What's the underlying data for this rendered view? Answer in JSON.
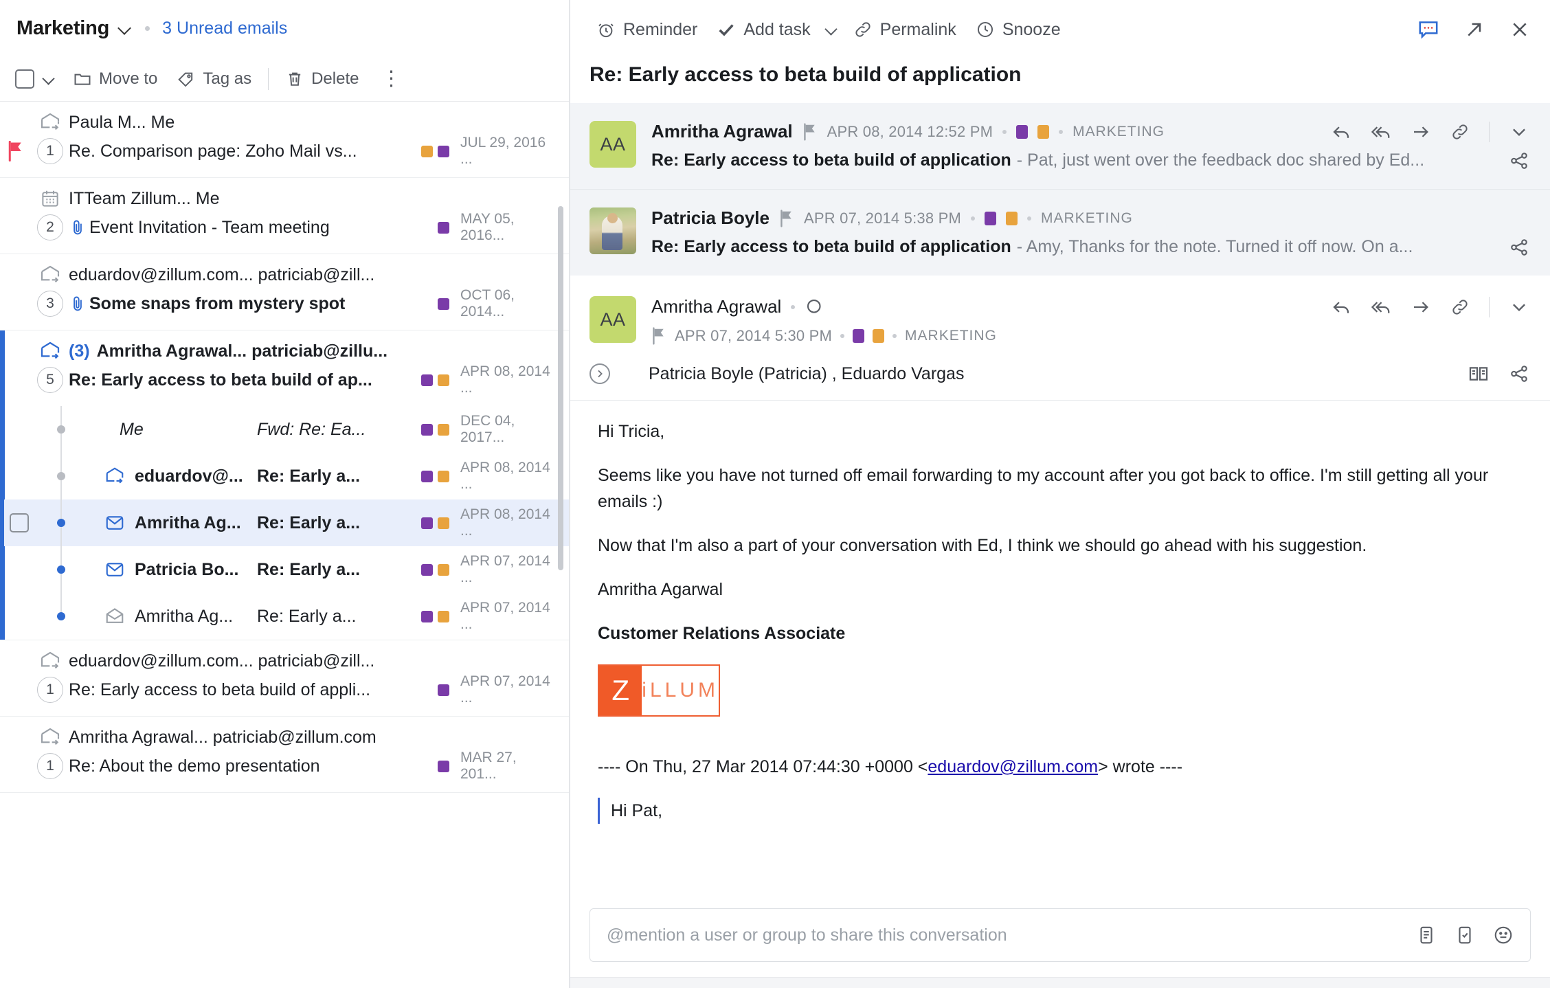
{
  "left": {
    "header": {
      "folder": "Marketing",
      "unread": "3 Unread emails"
    },
    "toolbar": {
      "move_to": "Move to",
      "tag_as": "Tag as",
      "delete": "Delete",
      "more": "⋮"
    },
    "threads": [
      {
        "senders": "Paula M... Me",
        "subject": "Re. Comparison page: Zoho Mail vs...",
        "count": "1",
        "date": "JUL 29, 2016 ...",
        "flagged": true,
        "tags": [
          "#e8a33d",
          "#7a3ba8"
        ],
        "icon": "envelope-forward-icon"
      },
      {
        "senders": "ITTeam Zillum... Me",
        "subject": "Event Invitation - Team meeting",
        "count": "2",
        "date": "MAY 05, 2016...",
        "flagged": false,
        "attachment": true,
        "tags": [
          "#7a3ba8"
        ],
        "icon": "calendar-icon"
      },
      {
        "senders": "eduardov@zillum.com... patriciab@zill...",
        "subject": "Some snaps from mystery spot",
        "count": "3",
        "date": "OCT 06, 2014...",
        "flagged": false,
        "attachment": true,
        "tags": [
          "#7a3ba8"
        ],
        "icon": "envelope-forward-icon"
      },
      {
        "senders_prefix": "(3)",
        "senders": "Amritha Agrawal... patriciab@zillu...",
        "subject": "Re: Early access to beta build of ap...",
        "count": "5",
        "date": "APR 08, 2014 ...",
        "unread": true,
        "active": true,
        "tags": [
          "#7a3ba8",
          "#e8a33d"
        ],
        "icon": "envelope-forward-icon"
      },
      {
        "senders": "eduardov@zillum.com... patriciab@zill...",
        "subject": "Re: Early access to beta build of appli...",
        "count": "1",
        "date": "APR 07, 2014 ...",
        "tags": [
          "#7a3ba8"
        ],
        "icon": "envelope-forward-icon"
      },
      {
        "senders": "Amritha Agrawal... patriciab@zillum.com",
        "subject": "Re: About the demo presentation",
        "count": "1",
        "date": "MAR 27, 201...",
        "tags": [
          "#7a3ba8"
        ],
        "icon": "envelope-forward-icon"
      }
    ],
    "subthreads": [
      {
        "sender": "Me",
        "subject": "Fwd: Re: Ea...",
        "date": "DEC 04, 2017...",
        "tags": [
          "#7a3ba8",
          "#e8a33d"
        ],
        "style": "italic",
        "icon": "none",
        "dot": "grey",
        "selected": false
      },
      {
        "sender": "eduardov@...",
        "subject": "Re: Early a...",
        "date": "APR 08, 2014 ...",
        "tags": [
          "#7a3ba8",
          "#e8a33d"
        ],
        "style": "bold",
        "icon": "envelope-forward-icon",
        "dot": "grey",
        "selected": false
      },
      {
        "sender": "Amritha Ag...",
        "subject": "Re: Early a...",
        "date": "APR 08, 2014 ...",
        "tags": [
          "#7a3ba8",
          "#e8a33d"
        ],
        "style": "bold",
        "icon": "envelope-closed-blue-icon",
        "dot": "blue",
        "selected": true
      },
      {
        "sender": "Patricia Bo...",
        "subject": "Re: Early a...",
        "date": "APR 07, 2014 ...",
        "tags": [
          "#7a3ba8",
          "#e8a33d"
        ],
        "style": "bold",
        "icon": "envelope-closed-blue-icon",
        "dot": "blue",
        "selected": false
      },
      {
        "sender": "Amritha Ag...",
        "subject": "Re: Early a...",
        "date": "APR 07, 2014 ...",
        "tags": [
          "#7a3ba8",
          "#e8a33d"
        ],
        "style": "normal",
        "icon": "envelope-open-icon",
        "dot": "blue",
        "selected": false
      }
    ]
  },
  "right": {
    "toolbar": {
      "reminder": "Reminder",
      "add_task": "Add task",
      "permalink": "Permalink",
      "snooze": "Snooze"
    },
    "subject": "Re: Early access to beta build of application",
    "messages": [
      {
        "sender": "Amritha Agrawal",
        "avatar_initials": "AA",
        "avatar_type": "initials",
        "avatar_color": "#c3d96e",
        "time": "APR 08, 2014 12:52 PM",
        "label": "MARKETING",
        "tags": [
          "#7a3ba8",
          "#e8a33d"
        ],
        "snippet_subject": "Re: Early access to beta build of application",
        "snippet_text": "- Pat, just went over the feedback doc shared by Ed...",
        "flagged": true
      },
      {
        "sender": "Patricia Boyle",
        "avatar_type": "photo",
        "time": "APR 07, 2014 5:38 PM",
        "label": "MARKETING",
        "tags": [
          "#7a3ba8",
          "#e8a33d"
        ],
        "snippet_subject": "Re: Early access to beta build of application",
        "snippet_text": "- Amy, Thanks for the note. Turned it off now. On a...",
        "flagged": true
      }
    ],
    "expanded": {
      "sender": "Amritha Agrawal",
      "avatar_initials": "AA",
      "avatar_color": "#c3d96e",
      "time": "APR 07, 2014 5:30 PM",
      "label": "MARKETING",
      "tags": [
        "#7a3ba8",
        "#e8a33d"
      ],
      "recipients": "Patricia Boyle (Patricia) , Eduardo Vargas",
      "body": {
        "greeting": "Hi Tricia,",
        "para1": "Seems like you have not turned off email forwarding to my account after you got back to office. I'm still getting all your emails :)",
        "para2": "Now that I'm also a part of your conversation with Ed, I think we should go ahead with his suggestion.",
        "sig_name": "Amritha Agarwal",
        "sig_title": "Customer Relations Associate",
        "logo_left": "Z",
        "logo_right": "iLLUM"
      },
      "quote": {
        "prefix": "---- On Thu, 27 Mar 2014 07:44:30 +0000 <",
        "email": "eduardov@zillum.com",
        "suffix": "> wrote ----",
        "text": "Hi Pat,"
      }
    },
    "mention": {
      "placeholder": "@mention a user or group to share this conversation",
      "value": ""
    }
  }
}
